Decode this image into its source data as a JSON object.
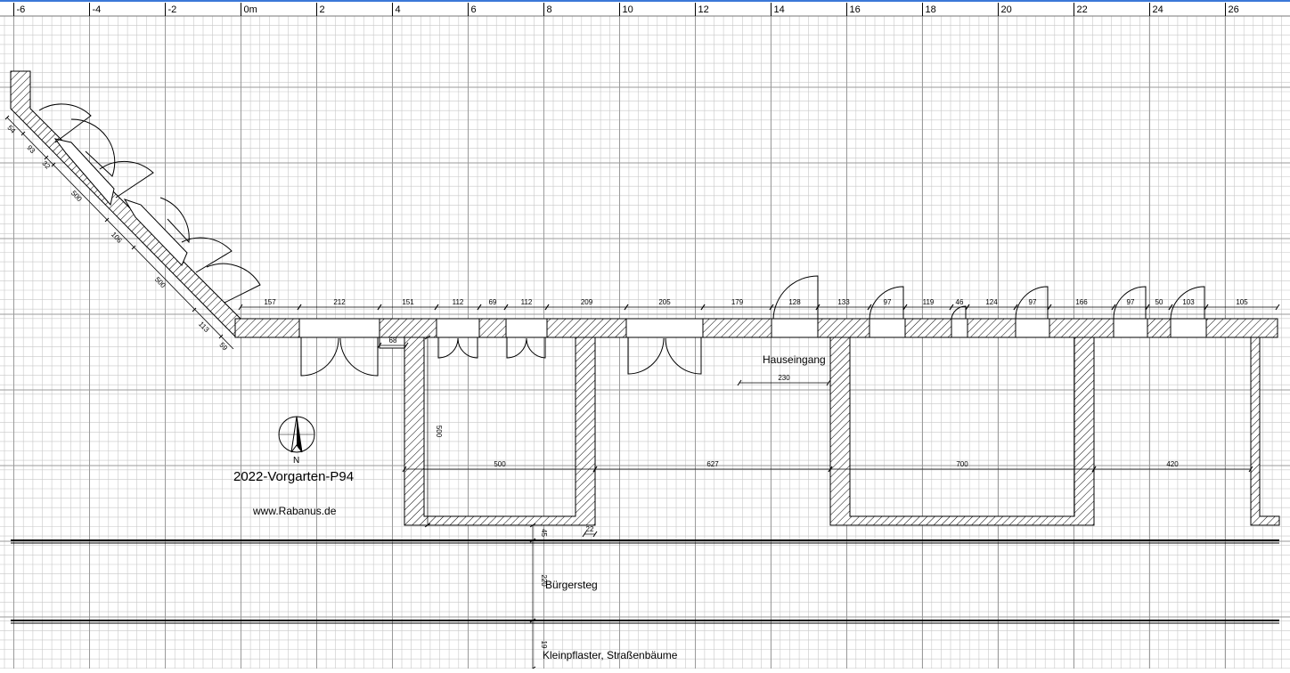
{
  "ruler": {
    "unit": "0m",
    "ticks": [
      "-6",
      "-4",
      "-2",
      "0m",
      "2",
      "4",
      "6",
      "8",
      "10",
      "12",
      "14",
      "16",
      "18",
      "20",
      "22",
      "24",
      "26"
    ]
  },
  "labels": {
    "title": "2022-Vorgarten-P94",
    "website": "www.Rabanus.de",
    "entrance": "Hauseingang",
    "sidewalk": "Bürgersteg",
    "street": "Kleinpflaster, Straßenbäume",
    "north": "N"
  },
  "dimensions": {
    "diagonal": [
      "54",
      "93",
      "32",
      "500",
      "106",
      "500",
      "113",
      "59"
    ],
    "top_wall": [
      "157",
      "212",
      "151",
      "112",
      "69",
      "112",
      "209",
      "205",
      "179",
      "128",
      "133",
      "97",
      "119",
      "46",
      "124",
      "97",
      "166",
      "97",
      "50",
      "103",
      "105"
    ],
    "small": "68",
    "entrance_width": "230",
    "depth": "500",
    "spans": [
      "500",
      "627",
      "700",
      "420"
    ],
    "offset_a": "45",
    "offset_b": "22",
    "sidewalk_width": "220",
    "street_width": "19"
  },
  "colors": {
    "accent": "#3b78d8",
    "grid_minor": "#c8c8c8",
    "grid_major": "#9a9a9a",
    "wall": "#000000"
  }
}
